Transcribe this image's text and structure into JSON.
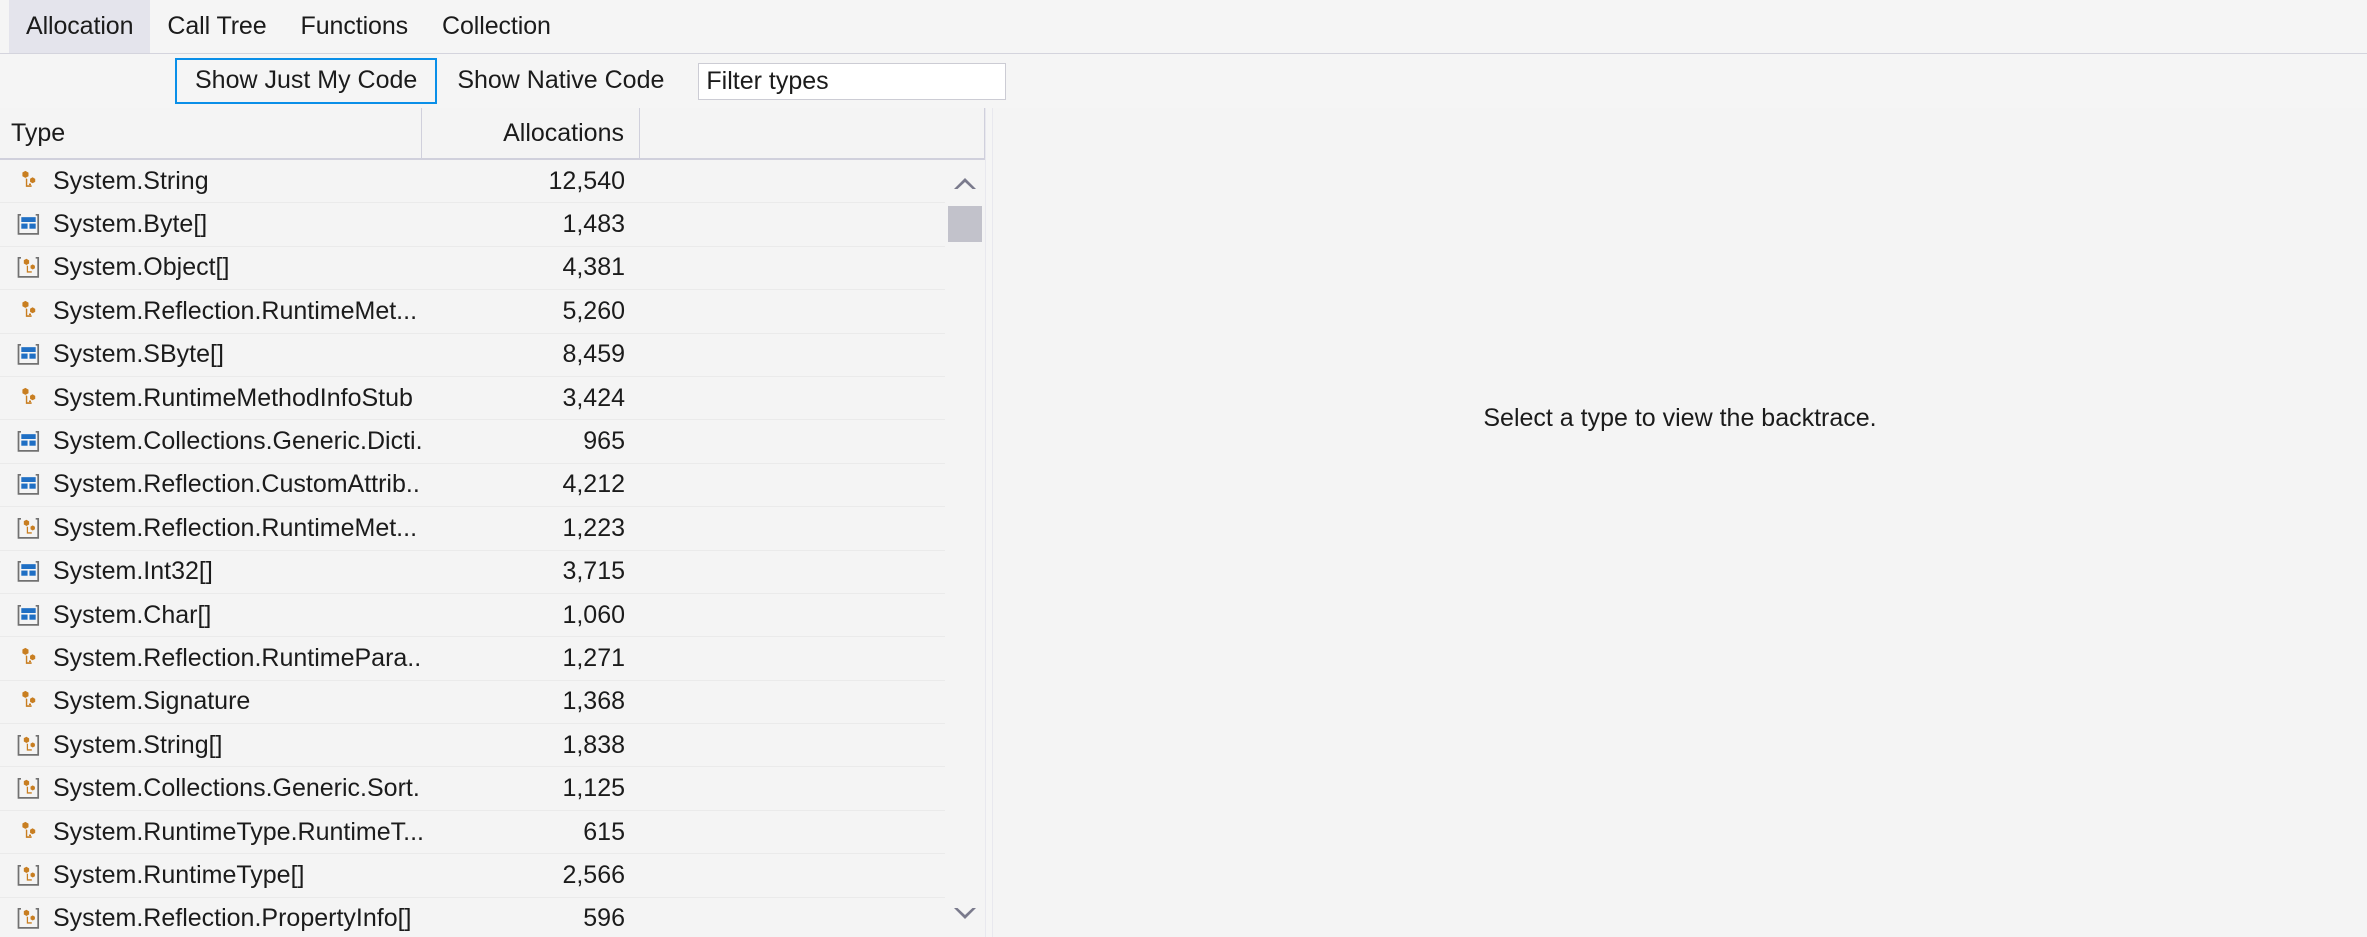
{
  "tabs": [
    {
      "label": "Allocation",
      "selected": true
    },
    {
      "label": "Call Tree",
      "selected": false
    },
    {
      "label": "Functions",
      "selected": false
    },
    {
      "label": "Collection",
      "selected": false
    }
  ],
  "toolbar": {
    "show_just_my_code_label": "Show Just My Code",
    "show_native_code_label": "Show Native Code",
    "filter_value": "Filter types",
    "filter_placeholder": "Filter types",
    "focus_color": "#0a8fe8"
  },
  "grid": {
    "columns": [
      {
        "key": "type",
        "label": "Type",
        "align": "left"
      },
      {
        "key": "allocations",
        "label": "Allocations",
        "align": "right"
      }
    ],
    "rows": [
      {
        "icon": "class-icon",
        "type": "System.String",
        "allocations": "12,540"
      },
      {
        "icon": "struct-array-icon",
        "type": "System.Byte[]",
        "allocations": "1,483"
      },
      {
        "icon": "class-array-icon",
        "type": "System.Object[]",
        "allocations": "4,381"
      },
      {
        "icon": "class-icon",
        "type": "System.Reflection.RuntimeMet...",
        "allocations": "5,260"
      },
      {
        "icon": "struct-array-icon",
        "type": "System.SByte[]",
        "allocations": "8,459"
      },
      {
        "icon": "class-icon",
        "type": "System.RuntimeMethodInfoStub",
        "allocations": "3,424"
      },
      {
        "icon": "struct-array-icon",
        "type": "System.Collections.Generic.Dicti...",
        "allocations": "965"
      },
      {
        "icon": "struct-array-icon",
        "type": "System.Reflection.CustomAttrib...",
        "allocations": "4,212"
      },
      {
        "icon": "class-array-icon",
        "type": "System.Reflection.RuntimeMet...",
        "allocations": "1,223"
      },
      {
        "icon": "struct-array-icon",
        "type": "System.Int32[]",
        "allocations": "3,715"
      },
      {
        "icon": "struct-array-icon",
        "type": "System.Char[]",
        "allocations": "1,060"
      },
      {
        "icon": "class-icon",
        "type": "System.Reflection.RuntimePara...",
        "allocations": "1,271"
      },
      {
        "icon": "class-icon",
        "type": "System.Signature",
        "allocations": "1,368"
      },
      {
        "icon": "class-array-icon",
        "type": "System.String[]",
        "allocations": "1,838"
      },
      {
        "icon": "class-array-icon",
        "type": "System.Collections.Generic.Sort...",
        "allocations": "1,125"
      },
      {
        "icon": "class-icon",
        "type": "System.RuntimeType.RuntimeT...",
        "allocations": "615"
      },
      {
        "icon": "class-array-icon",
        "type": "System.RuntimeType[]",
        "allocations": "2,566"
      },
      {
        "icon": "class-array-icon",
        "type": "System.Reflection.PropertyInfo[]",
        "allocations": "596"
      }
    ]
  },
  "scrollbar": {
    "up_arrow": "chevron-up-icon",
    "down_arrow": "chevron-down-icon",
    "thumb_color": "#c2c2cb"
  },
  "detail_pane": {
    "message": "Select a type to view the backtrace."
  }
}
